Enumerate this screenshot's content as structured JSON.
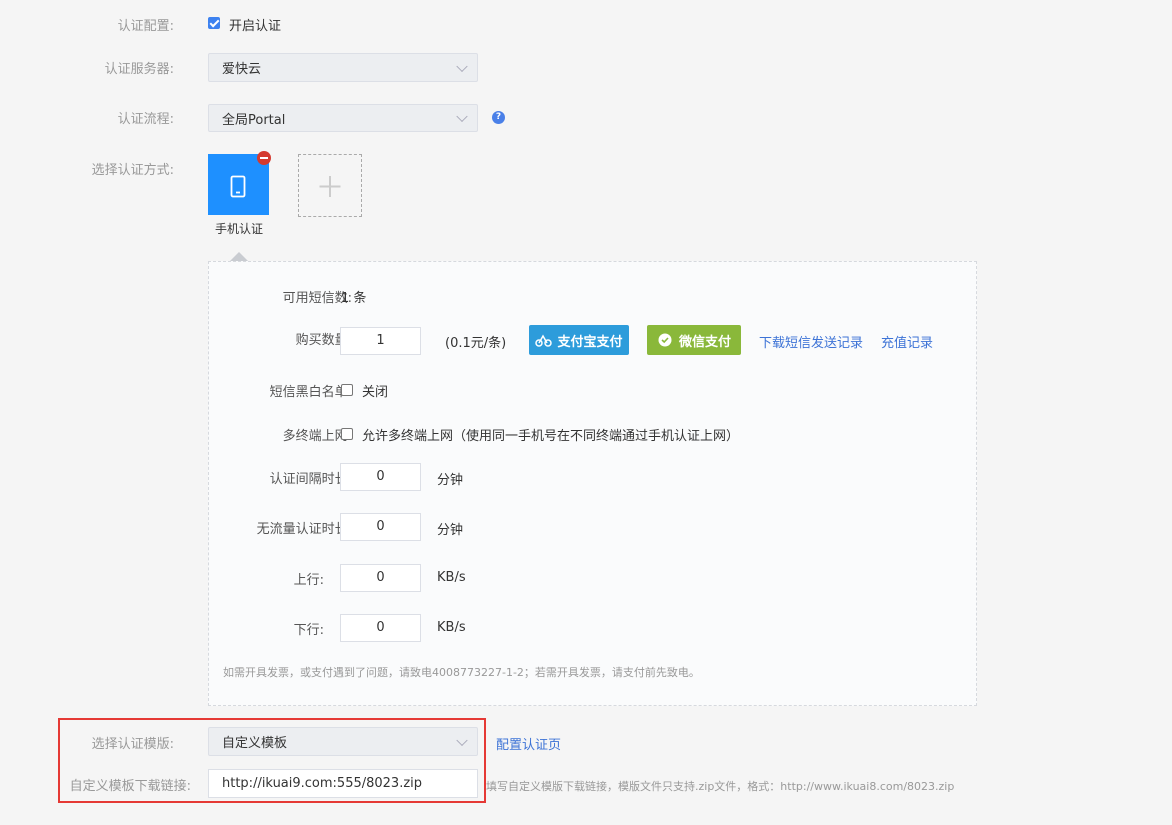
{
  "auth_config": {
    "label": "认证配置:",
    "checkbox_label": "开启认证",
    "checked": true
  },
  "auth_server": {
    "label": "认证服务器:",
    "value": "爱快云"
  },
  "auth_flow": {
    "label": "认证流程:",
    "value": "全局Portal",
    "help_icon": "question-circle-icon"
  },
  "auth_method": {
    "label": "选择认证方式:",
    "tile_label": "手机认证",
    "tile_icon": "mobile-phone-icon",
    "remove_icon": "minus-circle-icon",
    "add_icon": "plus-icon",
    "tile_color": "#1e90ff"
  },
  "sms": {
    "available_label": "可用短信数:",
    "available_value": "1 条",
    "buy_label": "购买数量:",
    "buy_value": "1",
    "price": "(0.1元/条)",
    "alipay_button": "支付宝支付",
    "alipay_color": "#2d9cdb",
    "wechat_button": "微信支付",
    "wechat_color": "#8ab83a",
    "download_link": "下载短信发送记录",
    "recharge_link": "充值记录",
    "blacklist_label": "短信黑白名单:",
    "blacklist_value": "关闭",
    "multi_label": "多终端上网:",
    "multi_value": "允许多终端上网（使用同一手机号在不同终端通过手机认证上网）",
    "interval_label": "认证间隔时长:",
    "interval_value": "0",
    "interval_unit": "分钟",
    "noflow_label": "无流量认证时长:",
    "noflow_value": "0",
    "noflow_unit": "分钟",
    "up_label": "上行:",
    "up_value": "0",
    "up_unit": "KB/s",
    "down_label": "下行:",
    "down_value": "0",
    "down_unit": "KB/s",
    "note": "如需开具发票，或支付遇到了问题，请致电4008773227-1-2；若需开具发票，请支付前先致电。"
  },
  "template": {
    "label": "选择认证模版:",
    "value": "自定义模板",
    "config_link": "配置认证页",
    "url_label": "自定义模板下载链接:",
    "url_value": "http://ikuai9.com:555/8023.zip",
    "url_hint": "填写自定义模版下载链接，模版文件只支持.zip文件，格式：http://www.ikuai8.com/8023.zip",
    "highlight_color": "#e53935"
  }
}
